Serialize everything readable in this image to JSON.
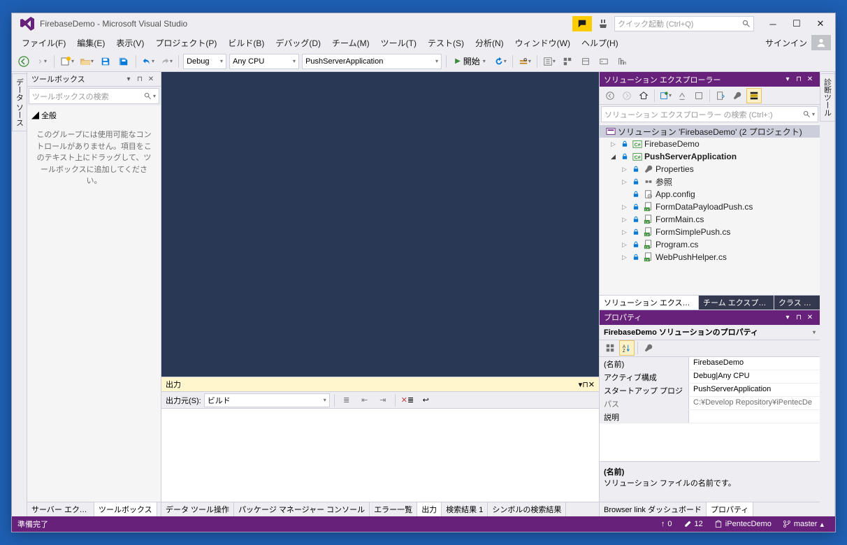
{
  "title": "FirebaseDemo - Microsoft Visual Studio",
  "quickLaunch": "クイック起動 (Ctrl+Q)",
  "signin": "サインイン",
  "menu": [
    "ファイル(F)",
    "編集(E)",
    "表示(V)",
    "プロジェクト(P)",
    "ビルド(B)",
    "デバッグ(D)",
    "チーム(M)",
    "ツール(T)",
    "テスト(S)",
    "分析(N)",
    "ウィンドウ(W)",
    "ヘルプ(H)"
  ],
  "toolbar": {
    "config": "Debug",
    "platform": "Any CPU",
    "startup": "PushServerApplication",
    "start": "開始"
  },
  "vtabs": {
    "left": "データ ソース",
    "right": "診断ツール"
  },
  "toolbox": {
    "title": "ツールボックス",
    "searchPlaceholder": "ツールボックスの検索",
    "group": "全般",
    "empty": "このグループには使用可能なコントロールがありません。項目をこのテキスト上にドラッグして、ツールボックスに追加してください。",
    "tabs": [
      "サーバー エクスプロ...",
      "ツールボックス"
    ]
  },
  "output": {
    "title": "出力",
    "sourceLabel": "出力元(S):",
    "source": "ビルド",
    "tabs": [
      "データ ツール操作",
      "パッケージ マネージャー コンソール",
      "エラー一覧",
      "出力",
      "検索結果 1",
      "シンボルの検索結果"
    ],
    "activeTab": 3
  },
  "solution": {
    "title": "ソリューション エクスプローラー",
    "searchPlaceholder": "ソリューション エクスプローラー の検索 (Ctrl+:)",
    "root": "ソリューション 'FirebaseDemo' (2 プロジェクト)",
    "tree": [
      {
        "depth": 1,
        "arrow": "closed",
        "icon": "cs",
        "label": "FirebaseDemo"
      },
      {
        "depth": 1,
        "arrow": "open",
        "icon": "cs",
        "label": "PushServerApplication",
        "bold": true
      },
      {
        "depth": 2,
        "arrow": "closed",
        "icon": "wrench",
        "label": "Properties"
      },
      {
        "depth": 2,
        "arrow": "closed",
        "icon": "ref",
        "label": "参照"
      },
      {
        "depth": 2,
        "arrow": "",
        "icon": "cfg",
        "label": "App.config"
      },
      {
        "depth": 2,
        "arrow": "closed",
        "icon": "csfile",
        "label": "FormDataPayloadPush.cs"
      },
      {
        "depth": 2,
        "arrow": "closed",
        "icon": "csfile",
        "label": "FormMain.cs"
      },
      {
        "depth": 2,
        "arrow": "closed",
        "icon": "csfile",
        "label": "FormSimplePush.cs"
      },
      {
        "depth": 2,
        "arrow": "closed",
        "icon": "csfile",
        "label": "Program.cs"
      },
      {
        "depth": 2,
        "arrow": "closed",
        "icon": "csfile",
        "label": "WebPushHelper.cs"
      }
    ],
    "tabs": [
      "ソリューション エクスプローラー",
      "チーム エクスプローラー",
      "クラス ビュー"
    ]
  },
  "properties": {
    "title": "プロパティ",
    "objName": "FirebaseDemo ソリューションのプロパティ",
    "rows": [
      {
        "k": "(名前)",
        "v": "FirebaseDemo"
      },
      {
        "k": "アクティブ構成",
        "v": "Debug|Any CPU"
      },
      {
        "k": "スタートアップ プロジェクト",
        "v": "PushServerApplication"
      },
      {
        "k": "パス",
        "v": "C:¥Develop Repository¥iPentecDe",
        "dim": true
      },
      {
        "k": "説明",
        "v": ""
      }
    ],
    "descTitle": "(名前)",
    "descBody": "ソリューション ファイルの名前です。",
    "tabs": [
      "Browser link ダッシュボード",
      "プロパティ"
    ]
  },
  "status": {
    "ready": "準備完了",
    "upCount": "0",
    "editCount": "12",
    "repo": "iPentecDemo",
    "branch": "master"
  }
}
